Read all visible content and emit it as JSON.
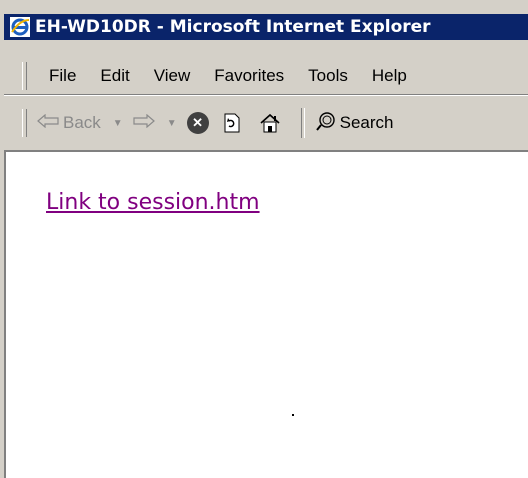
{
  "window": {
    "title": "EH-WD10DR - Microsoft Internet Explorer"
  },
  "menubar": {
    "items": [
      "File",
      "Edit",
      "View",
      "Favorites",
      "Tools",
      "Help"
    ]
  },
  "toolbar": {
    "back_label": "Back",
    "search_label": "Search",
    "icons": [
      "back-arrow-icon",
      "dropdown-arrow-icon",
      "forward-arrow-icon",
      "stop-icon",
      "refresh-icon",
      "home-icon",
      "search-icon"
    ]
  },
  "content": {
    "link_text": "Link to session.htm"
  },
  "colors": {
    "titlebar": "#0a246a",
    "chrome": "#d4d0c8",
    "visited_link": "#800080"
  }
}
